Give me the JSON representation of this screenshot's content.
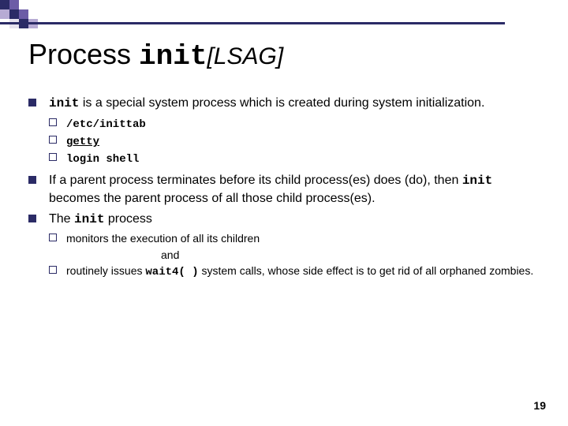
{
  "title": {
    "prefix": "Process ",
    "code": "init",
    "suffix": "[LSAG]"
  },
  "bullets": {
    "b1": {
      "pre": "init",
      "post": " is a special system process which is created during system initialization.",
      "subs": {
        "s1": "/etc/inittab",
        "s2": "getty",
        "s3": "login shell"
      }
    },
    "b2": {
      "t1": "If a parent process terminates before its child process(es) does (do), then ",
      "code": "init",
      "t2": " becomes the parent process of all those child process(es)."
    },
    "b3": {
      "t1": "The ",
      "code": "init",
      "t2": " process",
      "subs": {
        "s1": "monitors the execution of all its children",
        "and": "and",
        "s2a": "routinely issues ",
        "s2code": "wait4( )",
        "s2b": " system calls, whose side effect is to get rid of all orphaned zombies."
      }
    }
  },
  "page_number": "19"
}
